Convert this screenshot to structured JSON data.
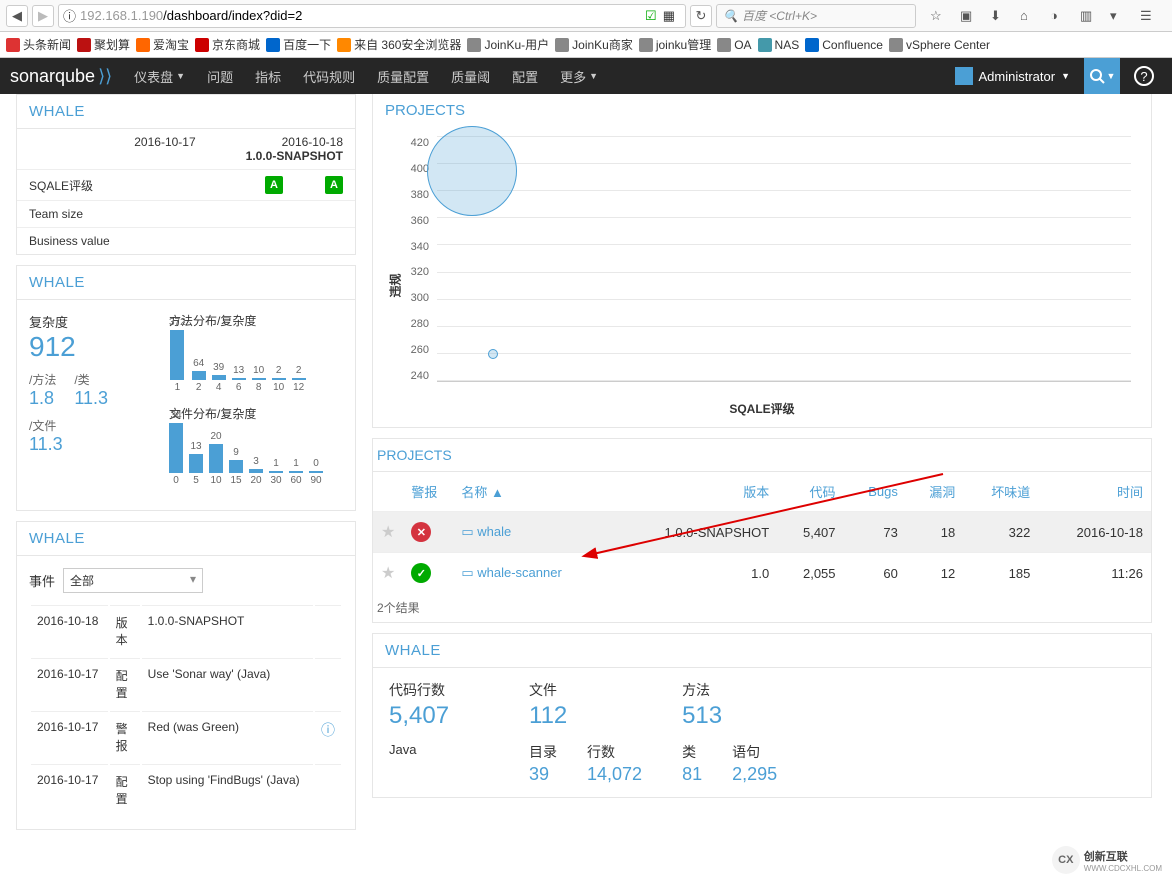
{
  "browser": {
    "url_prefix": "192.168.1.190",
    "url_path": "/dashboard/index?did=2",
    "search_placeholder": "百度 <Ctrl+K>"
  },
  "bookmarks": [
    {
      "label": "头条新闻",
      "color": "#d33"
    },
    {
      "label": "聚划算",
      "color": "#b11"
    },
    {
      "label": "爱淘宝",
      "color": "#f60"
    },
    {
      "label": "京东商城",
      "color": "#c00"
    },
    {
      "label": "百度一下",
      "color": "#06c"
    },
    {
      "label": "来自 360安全浏览器",
      "color": "#f80"
    },
    {
      "label": "JoinKu-用户",
      "color": "#888"
    },
    {
      "label": "JoinKu商家",
      "color": "#888"
    },
    {
      "label": "joinku管理",
      "color": "#888"
    },
    {
      "label": "OA",
      "color": "#888"
    },
    {
      "label": "NAS",
      "color": "#49a"
    },
    {
      "label": "Confluence",
      "color": "#06c"
    },
    {
      "label": "vSphere Center",
      "color": "#888"
    }
  ],
  "sonar": {
    "logo": "sonarqube",
    "menu": [
      "仪表盘",
      "问题",
      "指标",
      "代码规则",
      "质量配置",
      "质量阈",
      "配置",
      "更多"
    ],
    "user": "Administrator"
  },
  "whale1": {
    "title": "WHALE",
    "col1_date": "2016-10-17",
    "col2_date": "2016-10-18",
    "col2_version": "1.0.0-SNAPSHOT",
    "rows": [
      {
        "label": "SQALE评级",
        "v1": "A",
        "v2": "A",
        "badge": true
      },
      {
        "label": "Team size"
      },
      {
        "label": "Business value"
      }
    ]
  },
  "whale2": {
    "title": "WHALE",
    "complexity_label": "复杂度",
    "complexity_value": "912",
    "per_method_label": "/方法",
    "per_method_value": "1.8",
    "per_class_label": "/类",
    "per_class_value": "11.3",
    "per_file_label": "/文件",
    "per_file_value": "11.3",
    "chart1_title": "方法分布/复杂度",
    "chart2_title": "文件分布/复杂度"
  },
  "chart_data": [
    {
      "type": "bar",
      "title": "方法分布/复杂度",
      "categories": [
        "1",
        "2",
        "4",
        "6",
        "8",
        "10",
        "12"
      ],
      "values": [
        372,
        64,
        39,
        13,
        10,
        2,
        2
      ]
    },
    {
      "type": "bar",
      "title": "文件分布/复杂度",
      "categories": [
        "0",
        "5",
        "10",
        "15",
        "20",
        "30",
        "60",
        "90"
      ],
      "values": [
        34,
        13,
        20,
        9,
        3,
        1,
        1,
        0
      ]
    },
    {
      "type": "scatter",
      "title": "PROJECTS",
      "xlabel": "SQALE评级",
      "ylabel": "违规",
      "ylim": [
        240,
        420
      ],
      "y_ticks": [
        240,
        260,
        280,
        300,
        320,
        340,
        360,
        380,
        400,
        420
      ],
      "points": [
        {
          "x": 0.05,
          "y": 395,
          "size": 90
        },
        {
          "x": 0.08,
          "y": 260,
          "size": 10
        }
      ]
    }
  ],
  "whale3": {
    "title": "WHALE",
    "event_label": "事件",
    "select_value": "全部",
    "events": [
      {
        "date": "2016-10-18",
        "cat": "版本",
        "desc": "1.0.0-SNAPSHOT"
      },
      {
        "date": "2016-10-17",
        "cat": "配置",
        "desc": "Use 'Sonar way' (Java)"
      },
      {
        "date": "2016-10-17",
        "cat": "警报",
        "desc": "Red (was Green)",
        "info": true
      },
      {
        "date": "2016-10-17",
        "cat": "配置",
        "desc": "Stop using 'FindBugs' (Java)"
      }
    ]
  },
  "projects_panel": {
    "title": "PROJECTS",
    "sub_title": "PROJECTS",
    "headers": {
      "alert": "警报",
      "name": "名称",
      "version": "版本",
      "loc": "代码",
      "bugs": "Bugs",
      "vuln": "漏洞",
      "smells": "坏味道",
      "time": "时间"
    },
    "rows": [
      {
        "alert": "fail",
        "name": "whale",
        "version": "1.0.0-SNAPSHOT",
        "loc": "5,407",
        "bugs": "73",
        "vuln": "18",
        "smells": "322",
        "time": "2016-10-18"
      },
      {
        "alert": "pass",
        "name": "whale-scanner",
        "version": "1.0",
        "loc": "2,055",
        "bugs": "60",
        "vuln": "12",
        "smells": "185",
        "time": "11:26"
      }
    ],
    "results_text": "2个结果"
  },
  "whale4": {
    "title": "WHALE",
    "stats": {
      "loc_label": "代码行数",
      "loc": "5,407",
      "files_label": "文件",
      "files": "112",
      "methods_label": "方法",
      "methods": "513",
      "lang": "Java",
      "dirs_label": "目录",
      "dirs": "39",
      "lines_label": "行数",
      "lines": "14,072",
      "classes_label": "类",
      "classes": "81",
      "stmts_label": "语句",
      "stmts": "2,295"
    }
  },
  "watermark": {
    "brand": "创新互联",
    "sub": "WWW.CDCXHL.COM"
  }
}
